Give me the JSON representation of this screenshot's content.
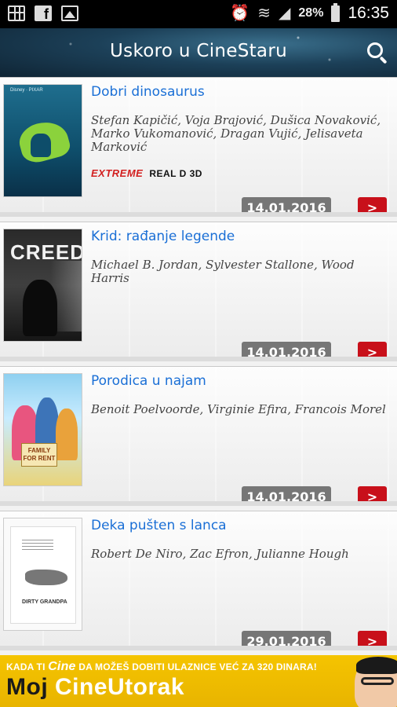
{
  "status_bar": {
    "battery_percent": "28%",
    "time": "16:35",
    "icons": [
      "grid-app-icon",
      "facebook-icon",
      "gallery-icon",
      "alarm-icon",
      "wifi-icon",
      "signal-icon",
      "battery-icon"
    ]
  },
  "header": {
    "title": "Uskoro u CineStaru",
    "search_icon": "search-icon"
  },
  "movies": [
    {
      "title": "Dobri dinosaurus",
      "cast": "Stefan Kapičić, Voja Brajović, Dušica Novaković, Marko Vukomanović, Dragan Vujić, Jelisaveta Marković",
      "formats": [
        "EXTREME",
        "REAL D 3D"
      ],
      "date": "14.01.2016",
      "action": ">"
    },
    {
      "title": "Krid: rađanje legende",
      "cast": "Michael B. Jordan, Sylvester Stallone, Wood Harris",
      "date": "14.01.2016",
      "action": ">",
      "poster_word": "CREED"
    },
    {
      "title": "Porodica u najam",
      "cast": "Benoit Poelvoorde, Virginie Efira, Francois Morel",
      "date": "14.01.2016",
      "action": ">",
      "poster_word": "FAMILY FOR RENT"
    },
    {
      "title": "Deka pušten s lanca",
      "cast": "Robert De Niro, Zac Efron, Julianne Hough",
      "date": "29.01.2016",
      "action": ">",
      "poster_word": "DIRTY GRANDPA"
    }
  ],
  "banner": {
    "top_text_1": "KADA TI",
    "top_brand": "Cine",
    "top_text_2": "DA MOŽEŠ DOBITI ULAZNICE VEĆ ZA 320 DINARA!",
    "main_text_1": "Moj ",
    "main_text_2": "CineUtorak"
  },
  "colors": {
    "header_bg": "#1c4058",
    "title_link": "#1a6fd6",
    "date_badge": "#767676",
    "arrow_button": "#c8101a",
    "banner_bg": "#f5c400"
  }
}
